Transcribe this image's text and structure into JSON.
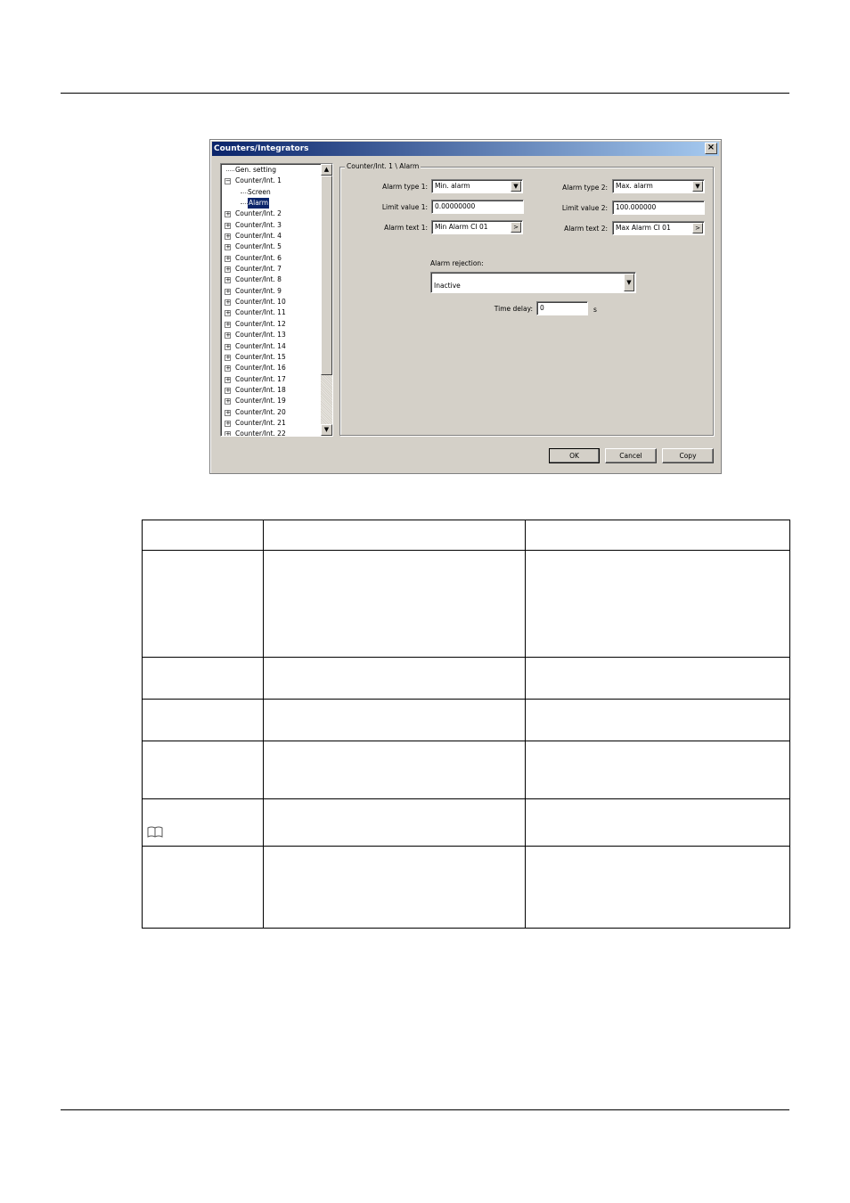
{
  "dialog": {
    "title": "Counters/Integrators",
    "close_glyph": "×",
    "tree": {
      "root_item": "Gen. setting",
      "expanded_item": "Counter/Int. 1",
      "children": [
        "Screen",
        "Alarm"
      ],
      "collapsed_items": [
        "Counter/Int. 2",
        "Counter/Int. 3",
        "Counter/Int. 4",
        "Counter/Int. 5",
        "Counter/Int. 6",
        "Counter/Int. 7",
        "Counter/Int. 8",
        "Counter/Int. 9",
        "Counter/Int. 10",
        "Counter/Int. 11",
        "Counter/Int. 12",
        "Counter/Int. 13",
        "Counter/Int. 14",
        "Counter/Int. 15",
        "Counter/Int. 16",
        "Counter/Int. 17",
        "Counter/Int. 18",
        "Counter/Int. 19",
        "Counter/Int. 20",
        "Counter/Int. 21",
        "Counter/Int. 22"
      ],
      "selected": "Alarm"
    },
    "panel": {
      "title": "Counter/Int. 1 \\ Alarm",
      "alarm_type_1_label": "Alarm type 1:",
      "alarm_type_1_value": "Min. alarm",
      "alarm_type_2_label": "Alarm type 2:",
      "alarm_type_2_value": "Max. alarm",
      "limit_value_1_label": "Limit value 1:",
      "limit_value_1_value": "0.00000000",
      "limit_value_2_label": "Limit value 2:",
      "limit_value_2_value": "100.000000",
      "alarm_text_1_label": "Alarm text 1:",
      "alarm_text_1_value": "Min Alarm CI 01",
      "alarm_text_2_label": "Alarm text 2:",
      "alarm_text_2_value": "Max Alarm CI 01",
      "browse_glyph": ">",
      "alarm_rejection_label": "Alarm rejection:",
      "alarm_rejection_value": "Inactive",
      "time_delay_label": "Time delay:",
      "time_delay_value": "0",
      "time_delay_unit": "s"
    },
    "buttons": {
      "ok": "OK",
      "cancel": "Cancel",
      "copy": "Copy"
    }
  },
  "icons": {
    "book": "book-icon"
  }
}
